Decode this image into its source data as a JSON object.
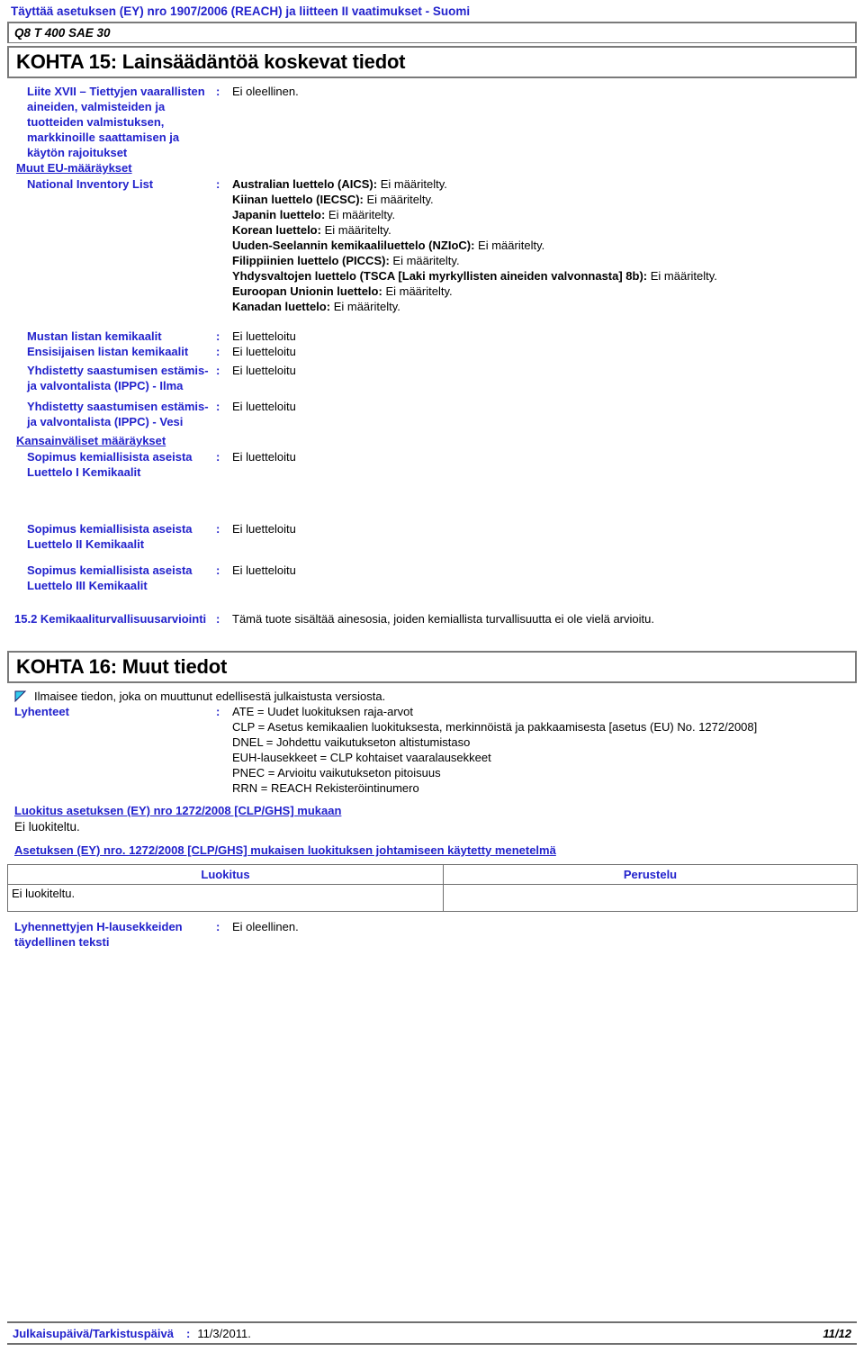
{
  "header": {
    "compliance": "Täyttää asetuksen (EY) nro 1907/2006 (REACH) ja liitteen II vaatimukset - Suomi",
    "product_name": "Q8 T 400 SAE 30",
    "section15_title": "KOHTA 15: Lainsäädäntöä koskevat tiedot"
  },
  "annex17": {
    "label": "Liite XVII – Tiettyjen vaarallisten aineiden, valmisteiden ja tuotteiden valmistuksen, markkinoille saattamisen ja käytön rajoitukset",
    "colon": ":",
    "value": "Ei oleellinen."
  },
  "other_eu_heading": "Muut EU-määräykset",
  "inventory": {
    "label": "National Inventory List",
    "colon": ":",
    "entries": [
      {
        "name": "Australian luettelo (AICS)",
        "sep": ":",
        "value": " Ei määritelty."
      },
      {
        "name": "Kiinan luettelo (IECSC)",
        "sep": ":",
        "value": " Ei määritelty."
      },
      {
        "name": "Japanin luettelo",
        "sep": ":",
        "value": " Ei määritelty."
      },
      {
        "name": "Korean luettelo",
        "sep": ":",
        "value": " Ei määritelty."
      },
      {
        "name": "Uuden-Seelannin kemikaaliluettelo (NZIoC)",
        "sep": ":",
        "value": " Ei määritelty."
      },
      {
        "name": "Filippiinien luettelo (PICCS)",
        "sep": ":",
        "value": " Ei määritelty."
      },
      {
        "name": "Yhdysvaltojen luettelo (TSCA [Laki myrkyllisten aineiden valvonnasta] 8b)",
        "sep": ":",
        "value": " Ei määritelty."
      },
      {
        "name": "Euroopan Unionin luettelo",
        "sep": ":",
        "value": " Ei määritelty."
      },
      {
        "name": "Kanadan luettelo",
        "sep": ":",
        "value": " Ei määritelty."
      }
    ]
  },
  "eu_rows": [
    {
      "label": "Mustan listan kemikaalit",
      "colon": ":",
      "value": "Ei luetteloitu"
    },
    {
      "label": "Ensisijaisen listan kemikaalit",
      "colon": ":",
      "value": "Ei luetteloitu"
    },
    {
      "label": "Yhdistetty saastumisen estämis- ja valvontalista (IPPC) - Ilma",
      "colon": ":",
      "value": "Ei luetteloitu"
    },
    {
      "label": "Yhdistetty saastumisen estämis- ja valvontalista (IPPC) - Vesi",
      "colon": ":",
      "value": "Ei luetteloitu"
    }
  ],
  "international_heading": "Kansainväliset määräykset",
  "intl_rows": [
    {
      "label": "Sopimus kemiallisista aseista Luettelo I Kemikaalit",
      "colon": ":",
      "value": "Ei luetteloitu"
    },
    {
      "label": "Sopimus kemiallisista aseista Luettelo II Kemikaalit",
      "colon": ":",
      "value": "Ei luetteloitu"
    },
    {
      "label": "Sopimus kemiallisista aseista Luettelo III Kemikaalit",
      "colon": ":",
      "value": "Ei luetteloitu"
    }
  ],
  "section152": {
    "label": "15.2 Kemikaaliturvallisuusarviointi",
    "colon": ":",
    "value": "Tämä tuote sisältää ainesosia, joiden kemiallista turvallisuutta ei ole vielä arvioitu."
  },
  "section16": {
    "title": "KOHTA 16: Muut tiedot",
    "flag_icon": "flag-triangle-icon",
    "flag_color": "#33ccee",
    "flag_text": "Ilmaisee tiedon, joka on muuttunut edellisestä julkaistusta versiosta.",
    "abbrev_label": "Lyhenteet",
    "abbrev_colon": ":",
    "abbreviations": [
      "ATE = Uudet luokituksen raja-arvot",
      "CLP = Asetus kemikaalien luokituksesta, merkinnöistä ja pakkaamisesta [asetus (EU) No. 1272/2008]",
      "DNEL = Johdettu vaikutukseton altistumistaso",
      "EUH-lausekkeet = CLP kohtaiset vaaralausekkeet",
      "PNEC = Arvioitu vaikutukseton pitoisuus",
      "RRN = REACH Rekisteröintinumero"
    ],
    "clp_heading": "Luokitus asetuksen (EY) nro 1272/2008 [CLP/GHS] mukaan",
    "clp_value": "Ei luokiteltu.",
    "method_heading": "Asetuksen (EY) nro. 1272/2008 [CLP/GHS] mukaisen luokituksen johtamiseen käytetty menetelmä",
    "table": {
      "headers": [
        "Luokitus",
        "Perustelu"
      ],
      "rows": [
        [
          "Ei luokiteltu.",
          ""
        ]
      ]
    },
    "h_statements": {
      "label": "Lyhennettyjen H-lausekkeiden täydellinen teksti",
      "colon": ":",
      "value": "Ei oleellinen."
    }
  },
  "footer": {
    "label": "Julkaisupäivä/Tarkistuspäivä",
    "colon": ":",
    "date": "11/3/2011.",
    "page": "11/12"
  },
  "colors": {
    "blue": "#2222cc",
    "border": "#6f6f6f",
    "flag": "#33ccee"
  }
}
